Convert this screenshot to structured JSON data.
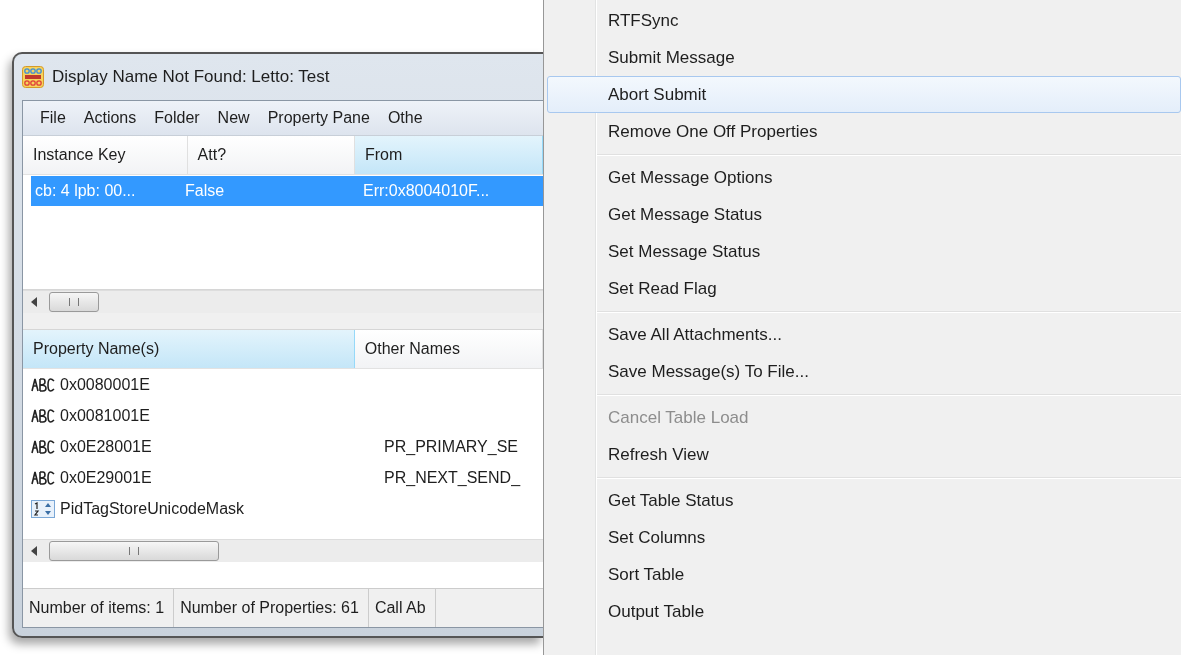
{
  "window": {
    "title": "Display Name Not Found: Letto: Test"
  },
  "menu_bar": [
    "File",
    "Actions",
    "Folder",
    "New",
    "Property Pane",
    "Othe"
  ],
  "contents_table": {
    "columns": [
      {
        "label": "Instance Key",
        "sorted": false
      },
      {
        "label": "Att?",
        "sorted": false
      },
      {
        "label": "From",
        "sorted": true
      }
    ],
    "rows": [
      {
        "cells": [
          "cb: 4 lpb: 00...",
          "False",
          "Err:0x8004010F..."
        ],
        "selected": true
      }
    ]
  },
  "properties_table": {
    "columns": [
      {
        "label": "Property Name(s)",
        "sorted": true
      },
      {
        "label": "Other Names",
        "sorted": false
      }
    ],
    "rows": [
      {
        "kind": "string",
        "name": "0x0080001E"
      },
      {
        "kind": "string",
        "name": "0x0081001E"
      },
      {
        "kind": "string",
        "name": "0x0E28001E",
        "other_names": "PR_PRIMARY_SE"
      },
      {
        "kind": "string",
        "name": "0x0E29001E",
        "other_names": "PR_NEXT_SEND_"
      },
      {
        "kind": "number",
        "name": "PidTagStoreUnicodeMask"
      }
    ]
  },
  "status_bar": [
    "Number of items: 1",
    "Number of Properties: 61",
    "Call Ab"
  ],
  "context_menu": {
    "items": [
      {
        "kind": "item",
        "label": "RTFSync",
        "highlighted": false,
        "disabled": false
      },
      {
        "kind": "item",
        "label": "Submit Message",
        "highlighted": false,
        "disabled": false
      },
      {
        "kind": "item",
        "label": "Abort Submit",
        "highlighted": true,
        "disabled": false
      },
      {
        "kind": "item",
        "label": "Remove One Off Properties",
        "highlighted": false,
        "disabled": false
      },
      {
        "kind": "separator"
      },
      {
        "kind": "item",
        "label": "Get Message Options",
        "highlighted": false,
        "disabled": false
      },
      {
        "kind": "item",
        "label": "Get Message Status",
        "highlighted": false,
        "disabled": false
      },
      {
        "kind": "item",
        "label": "Set Message Status",
        "highlighted": false,
        "disabled": false
      },
      {
        "kind": "item",
        "label": "Set Read Flag",
        "highlighted": false,
        "disabled": false
      },
      {
        "kind": "separator"
      },
      {
        "kind": "item",
        "label": "Save All Attachments...",
        "highlighted": false,
        "disabled": false
      },
      {
        "kind": "item",
        "label": "Save Message(s) To File...",
        "highlighted": false,
        "disabled": false
      },
      {
        "kind": "separator"
      },
      {
        "kind": "item",
        "label": "Cancel Table Load",
        "highlighted": false,
        "disabled": true
      },
      {
        "kind": "item",
        "label": "Refresh View",
        "highlighted": false,
        "disabled": false
      },
      {
        "kind": "separator"
      },
      {
        "kind": "item",
        "label": "Get Table Status",
        "highlighted": false,
        "disabled": false
      },
      {
        "kind": "item",
        "label": "Set Columns",
        "highlighted": false,
        "disabled": false
      },
      {
        "kind": "item",
        "label": "Sort Table",
        "highlighted": false,
        "disabled": false
      },
      {
        "kind": "item",
        "label": "Output Table",
        "highlighted": false,
        "disabled": false
      }
    ]
  }
}
